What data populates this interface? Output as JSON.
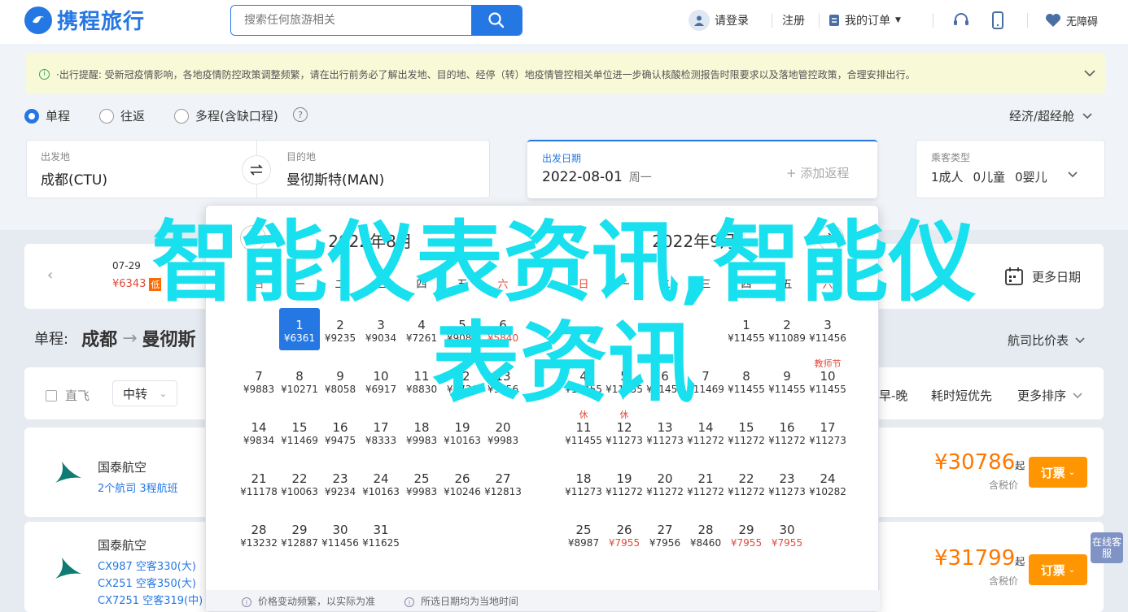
{
  "header": {
    "logo_text": "携程旅行",
    "search_placeholder": "搜索任何旅游相关",
    "login": "请登录",
    "register": "注册",
    "orders": "我的订单",
    "accessibility": "无障碍"
  },
  "notice": {
    "text": "·出行提醒: 受新冠疫情影响，各地疫情防控政策调整频繁，请在出行前务必了解出发地、目的地、经停（转）地疫情管控相关单位进一步确认核酸检测报告时限要求以及落地管控政策，合理安排出行。"
  },
  "trip_type": {
    "one_way": "单程",
    "round_trip": "往返",
    "multi": "多程(含缺口程)",
    "help": "?",
    "cabin": "经济/超经舱"
  },
  "search_form": {
    "from_label": "出发地",
    "from_value": "成都(CTU)",
    "to_label": "目的地",
    "to_value": "曼彻斯特(MAN)",
    "date_label": "出发日期",
    "date_value": "2022-08-01",
    "weekday": "周一",
    "add_return": "+ 添加返程",
    "pax_label": "乘客类型",
    "adults": "1成人",
    "children": "0儿童",
    "infants": "0婴儿"
  },
  "date_strip": {
    "date": "07-29",
    "price": "¥6343",
    "tag": "低",
    "more_dates": "更多日期"
  },
  "route": {
    "prefix": "单程:",
    "from": "成都",
    "to": "曼彻斯",
    "compare": "航司比价表"
  },
  "filters": {
    "direct": "直飞",
    "transfer": "中转",
    "morning_evening": "早-晚",
    "shortest": "耗时短优先",
    "more_sort": "更多排序"
  },
  "flights": [
    {
      "airline": "国泰航空",
      "route_summary": "2个航司  3程航班",
      "lines": [],
      "price": "¥30786",
      "qi": "起",
      "tax": "含税价",
      "book": "订票"
    },
    {
      "airline": "国泰航空",
      "route_summary": "",
      "lines": [
        "CX987 空客330(大)",
        "CX251 空客350(大)",
        "CX7251 空客319(中)"
      ],
      "price": "¥31799",
      "qi": "起",
      "tax": "含税价",
      "book": "订票"
    }
  ],
  "calendar": {
    "left_title": "2022年8月",
    "right_title": "2022年9月",
    "weekdays": [
      "日",
      "一",
      "二",
      "三",
      "四",
      "五",
      "六"
    ],
    "left_days": [
      {
        "d": "1",
        "p": "¥6361",
        "sel": true
      },
      {
        "d": "2",
        "p": "¥9235"
      },
      {
        "d": "3",
        "p": "¥9034"
      },
      {
        "d": "4",
        "p": "¥7261"
      },
      {
        "d": "5",
        "p": "¥9083"
      },
      {
        "d": "6",
        "p": "¥5840",
        "low": true
      },
      {
        "d": "7",
        "p": "¥9883"
      },
      {
        "d": "8",
        "p": "¥10271"
      },
      {
        "d": "9",
        "p": "¥8058"
      },
      {
        "d": "10",
        "p": "¥6917"
      },
      {
        "d": "11",
        "p": "¥8830"
      },
      {
        "d": "12",
        "p": "¥8736"
      },
      {
        "d": "13",
        "p": "¥9156"
      },
      {
        "d": "14",
        "p": "¥9834"
      },
      {
        "d": "15",
        "p": "¥11469"
      },
      {
        "d": "16",
        "p": "¥9475"
      },
      {
        "d": "17",
        "p": "¥8333"
      },
      {
        "d": "18",
        "p": "¥9983"
      },
      {
        "d": "19",
        "p": "¥10163"
      },
      {
        "d": "20",
        "p": "¥9983"
      },
      {
        "d": "21",
        "p": "¥11178"
      },
      {
        "d": "22",
        "p": "¥10063"
      },
      {
        "d": "23",
        "p": "¥9234"
      },
      {
        "d": "24",
        "p": "¥10163"
      },
      {
        "d": "25",
        "p": "¥9983"
      },
      {
        "d": "26",
        "p": "¥10246"
      },
      {
        "d": "27",
        "p": "¥12813"
      },
      {
        "d": "28",
        "p": "¥13232"
      },
      {
        "d": "29",
        "p": "¥12887"
      },
      {
        "d": "30",
        "p": "¥11456"
      },
      {
        "d": "31",
        "p": "¥11625"
      }
    ],
    "right_days": [
      {
        "d": "1",
        "p": "¥11455"
      },
      {
        "d": "2",
        "p": "¥11089"
      },
      {
        "d": "3",
        "p": "¥11456"
      },
      {
        "d": "4",
        "p": "¥11455"
      },
      {
        "d": "5",
        "p": "¥11455"
      },
      {
        "d": "6",
        "p": "¥11455"
      },
      {
        "d": "7",
        "p": "¥11469"
      },
      {
        "d": "8",
        "p": "¥11455"
      },
      {
        "d": "9",
        "p": "¥11455"
      },
      {
        "d": "10",
        "p": "¥11455",
        "hol": "教师节"
      },
      {
        "d": "11",
        "p": "¥11455",
        "hol": "休"
      },
      {
        "d": "12",
        "p": "¥11273",
        "hol": "休"
      },
      {
        "d": "13",
        "p": "¥11273"
      },
      {
        "d": "14",
        "p": "¥11272"
      },
      {
        "d": "15",
        "p": "¥11272"
      },
      {
        "d": "16",
        "p": "¥11272"
      },
      {
        "d": "17",
        "p": "¥11273"
      },
      {
        "d": "18",
        "p": "¥11273"
      },
      {
        "d": "19",
        "p": "¥11272"
      },
      {
        "d": "20",
        "p": "¥11272"
      },
      {
        "d": "21",
        "p": "¥11272"
      },
      {
        "d": "22",
        "p": "¥11272"
      },
      {
        "d": "23",
        "p": "¥11273"
      },
      {
        "d": "24",
        "p": "¥10282"
      },
      {
        "d": "25",
        "p": "¥8987"
      },
      {
        "d": "26",
        "p": "¥7955",
        "low": true
      },
      {
        "d": "27",
        "p": "¥7956"
      },
      {
        "d": "28",
        "p": "¥8460"
      },
      {
        "d": "29",
        "p": "¥7955",
        "low": true
      },
      {
        "d": "30",
        "p": "¥7955",
        "low": true
      }
    ],
    "foot_note1": "价格变动频繁，以实际为准",
    "foot_note2": "所选日期均为当地时间"
  },
  "overlay": {
    "line1": "智能仪表资讯,智能仪",
    "line2": "表资讯"
  },
  "online_service": "在线客服"
}
